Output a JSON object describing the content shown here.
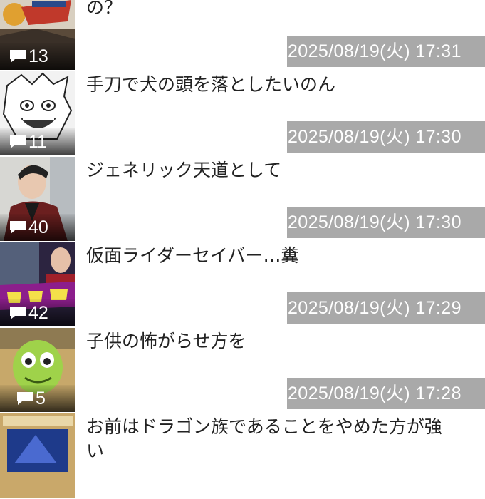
{
  "articles": [
    {
      "title": "どうして強化アイテムを両方怪盗側が使うの？",
      "comment_count": "13",
      "date": "2025/08/19(火) 17:31",
      "thumb_icon": "bold-name-poster-thumbnail"
    },
    {
      "title": "手刀で犬の頭を落としたいのん",
      "comment_count": "11",
      "date": "2025/08/19(火) 17:30",
      "thumb_icon": "manga-screaming-face-thumbnail"
    },
    {
      "title": "ジェネリック天道として",
      "comment_count": "40",
      "date": "2025/08/19(火) 17:30",
      "thumb_icon": "actor-portrait-thumbnail"
    },
    {
      "title": "仮面ライダーセイバー…糞",
      "comment_count": "42",
      "date": "2025/08/19(火) 17:29",
      "thumb_icon": "pakuri-magazine-thumbnail"
    },
    {
      "title": "子供の怖がらせ方を",
      "comment_count": "5",
      "date": "2025/08/19(火) 17:28",
      "thumb_icon": "green-monster-face-thumbnail"
    },
    {
      "title": "お前はドラゴン族であることをやめた方が強い",
      "comment_count": "",
      "date": "",
      "thumb_icon": "trading-card-thumbnail"
    }
  ],
  "colors": {
    "date_bg": "#a9a9a9",
    "title_text": "#222222",
    "count_text": "#ffffff"
  }
}
